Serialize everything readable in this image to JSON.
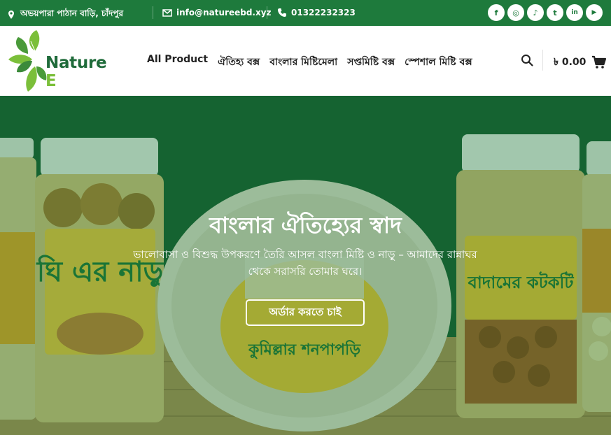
{
  "topbar": {
    "address": "অভয়পারা পাঠান বাড়ি, চাঁদপুর",
    "email": "info@natureebd.xyz",
    "phone": "01322232323",
    "socials": [
      {
        "icon": "facebook-icon",
        "glyph": "f"
      },
      {
        "icon": "instagram-icon",
        "glyph": "◎"
      },
      {
        "icon": "tiktok-icon",
        "glyph": "♪"
      },
      {
        "icon": "twitter-icon",
        "glyph": "t"
      },
      {
        "icon": "linkedin-icon",
        "glyph": "in"
      },
      {
        "icon": "youtube-icon",
        "glyph": "▶"
      }
    ]
  },
  "header": {
    "brand_main": "Nature",
    "brand_accent": "E",
    "nav": [
      "All Product",
      "ঐতিহ্য বক্স",
      "বাংলার মিষ্টিমেলা",
      "সপ্তমিষ্টি বক্স",
      "স্পেশাল মিষ্টি বক্স"
    ],
    "cart_total": "৳ 0.00"
  },
  "hero": {
    "title": "বাংলার ঐতিহ্যের স্বাদ",
    "subtitle": "ভালোবাসা ও বিশুদ্ধ উপকরণে তৈরি আসল বাংলা মিষ্টি ও নাড়ু – আমাদের রান্নাঘর থেকে সরাসরি তোমার ঘরে।",
    "cta": "অর্ডার করতে চাই",
    "jar_labels": [
      "ঘি এর নাড়ু",
      "বাদামের কটকটি",
      "কুমিল্লার শনপাপড়ি"
    ]
  },
  "colors": {
    "topbar": "#1e7a3c",
    "brand_green": "#1f6b3a",
    "brand_accent": "#7bbf3a",
    "hero_overlay": "#18823c"
  }
}
